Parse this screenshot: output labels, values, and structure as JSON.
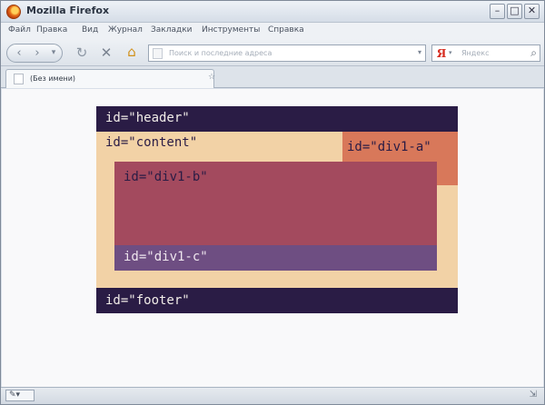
{
  "window": {
    "title": "Mozilla Firefox"
  },
  "menu": [
    "Файл",
    "Правка",
    "Вид",
    "Журнал",
    "Закладки",
    "Инструменты",
    "Справка"
  ],
  "toolbar": {
    "address_placeholder": "Поиск и последние адреса",
    "search_placeholder": "Яндекс",
    "search_engine_glyph": "Я"
  },
  "tab": {
    "label": "(Без имени)"
  },
  "content": {
    "header": "id=\"header\"",
    "content": "id=\"content\"",
    "div1a": "id=\"div1-a\"",
    "div1b": "id=\"div1-b\"",
    "div1c": "id=\"div1-c\"",
    "footer": "id=\"footer\""
  },
  "colors": {
    "header_footer": "#2a1c45",
    "content": "#f2d2a6",
    "div1_a": "#d8785a",
    "div1_b": "#a34a5e",
    "div1_c": "#6e4e82"
  }
}
